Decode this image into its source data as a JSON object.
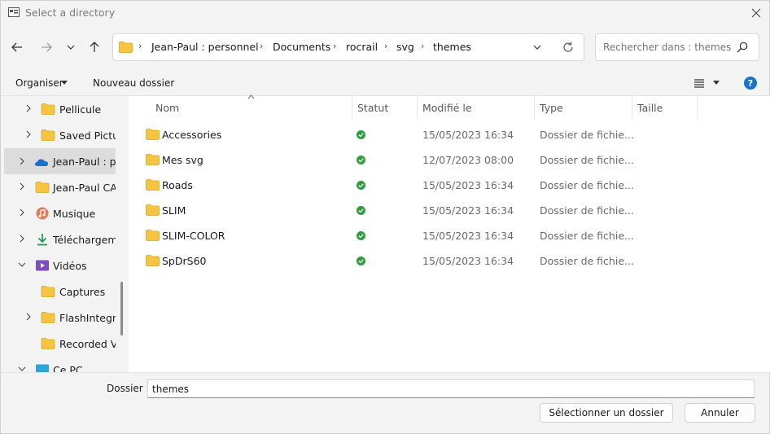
{
  "window": {
    "title": "Select a directory"
  },
  "address": {
    "crumbs": [
      "Jean-Paul : personnel",
      "Documents",
      "rocrail",
      "svg",
      "themes"
    ]
  },
  "search": {
    "placeholder": "Rechercher dans : themes"
  },
  "commandbar": {
    "organise_label": "Organiser",
    "new_folder_label": "Nouveau dossier",
    "help_label": "?"
  },
  "nav": {
    "items": [
      {
        "label": "Pellicule",
        "icon": "folder-icon"
      },
      {
        "label": "Saved Pictur",
        "icon": "folder-icon"
      },
      {
        "label": "Jean-Paul : pe",
        "icon": "onedrive-cloud-icon",
        "selected": true
      },
      {
        "label": "Jean-Paul CA",
        "icon": "folder-icon"
      },
      {
        "label": "Musique",
        "icon": "music-icon"
      },
      {
        "label": "Téléchargeme",
        "icon": "download-icon"
      },
      {
        "label": "Vidéos",
        "icon": "video-icon",
        "expanded": true
      },
      {
        "label": "Captures",
        "icon": "folder-icon"
      },
      {
        "label": "FlashIntegro",
        "icon": "folder-icon"
      },
      {
        "label": "Recorded V",
        "icon": "folder-icon"
      },
      {
        "label": "Ce PC",
        "icon": "computer-icon"
      }
    ]
  },
  "columns": {
    "name": "Nom",
    "status": "Statut",
    "modified": "Modifié le",
    "type": "Type",
    "size": "Taille"
  },
  "files": [
    {
      "name": "Accessories",
      "modified": "15/05/2023 16:34",
      "type": "Dossier de fichie..."
    },
    {
      "name": "Mes svg",
      "modified": "12/07/2023 08:00",
      "type": "Dossier de fichie..."
    },
    {
      "name": "Roads",
      "modified": "15/05/2023 16:34",
      "type": "Dossier de fichie..."
    },
    {
      "name": "SLIM",
      "modified": "15/05/2023 16:34",
      "type": "Dossier de fichie..."
    },
    {
      "name": "SLIM-COLOR",
      "modified": "15/05/2023 16:34",
      "type": "Dossier de fichie..."
    },
    {
      "name": "SpDrS60",
      "modified": "15/05/2023 16:34",
      "type": "Dossier de fichie..."
    }
  ],
  "footer": {
    "folder_label": "Dossier :",
    "folder_value": "themes",
    "select_label": "Sélectionner un dossier",
    "cancel_label": "Annuler"
  },
  "colors": {
    "folder": "#f5c542",
    "status_ok": "#2e9e3e",
    "accent": "#1a73c8"
  }
}
